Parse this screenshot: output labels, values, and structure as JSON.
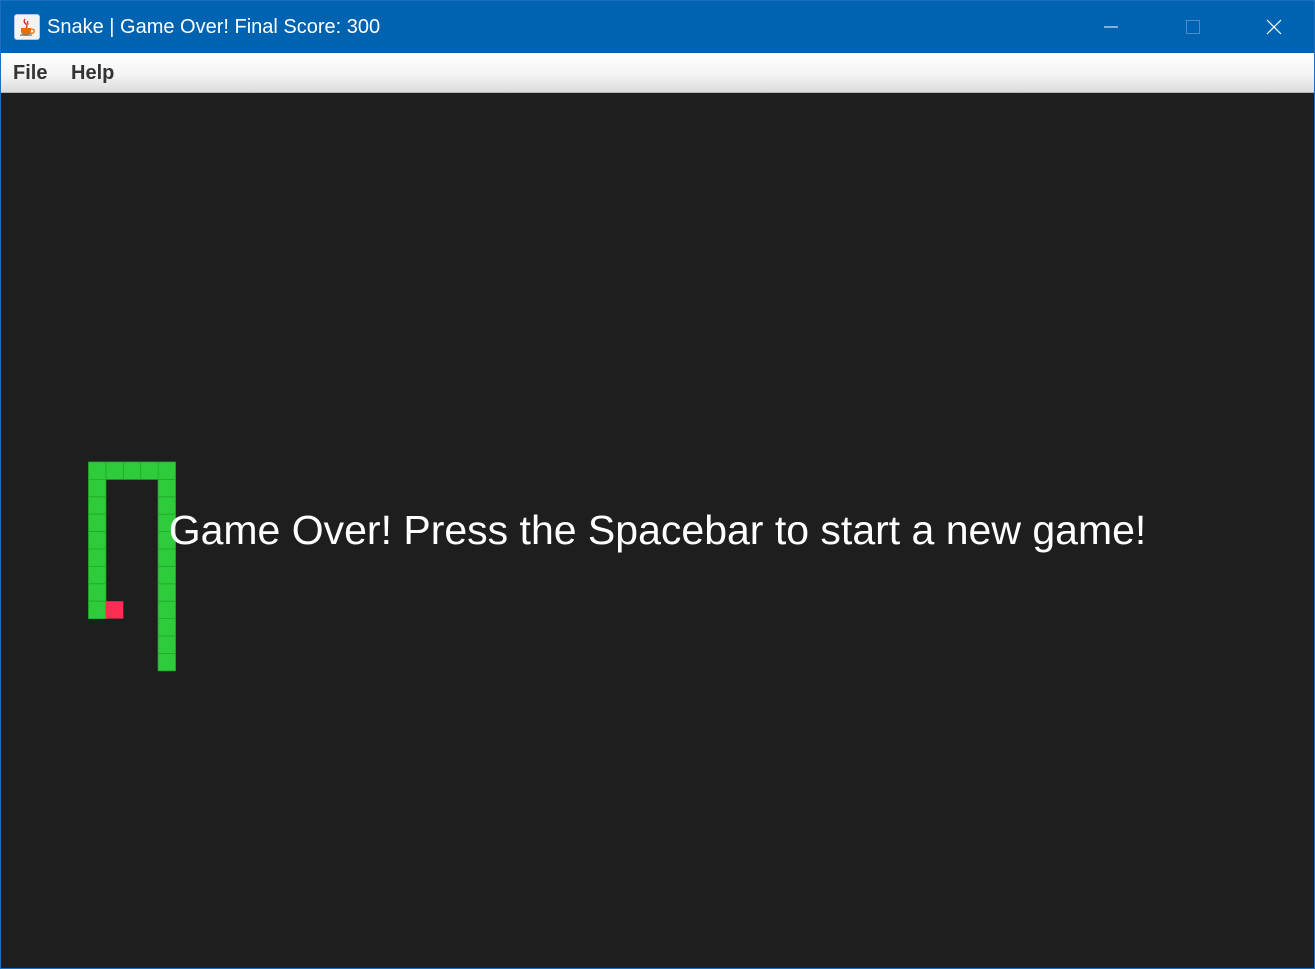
{
  "window": {
    "title": "Snake | Game Over! Final Score: 300",
    "app_icon": "java-cup-icon"
  },
  "window_controls": {
    "minimize_icon": "minimize-icon",
    "maximize_icon": "maximize-icon",
    "close_icon": "close-icon"
  },
  "menubar": {
    "items": [
      {
        "label": "File"
      },
      {
        "label": "Help"
      }
    ]
  },
  "game": {
    "message": "Game Over! Press the Spacebar to start a new game!",
    "final_score": 300,
    "colors": {
      "background": "#1e1e1e",
      "snake": "#2ecc3a",
      "snake_grid": "#22a82d",
      "food": "#ff2d55",
      "titlebar": "#0063b1"
    },
    "grid": {
      "cell_px_note": "cells",
      "snake_cells": [
        [
          9,
          31
        ],
        [
          9,
          30
        ],
        [
          9,
          29
        ],
        [
          9,
          28
        ],
        [
          9,
          27
        ],
        [
          9,
          26
        ],
        [
          9,
          25
        ],
        [
          9,
          24
        ],
        [
          9,
          23
        ],
        [
          9,
          22
        ],
        [
          9,
          21
        ],
        [
          9,
          20
        ],
        [
          8,
          20
        ],
        [
          7,
          20
        ],
        [
          6,
          20
        ],
        [
          5,
          20
        ],
        [
          5,
          21
        ],
        [
          5,
          22
        ],
        [
          5,
          23
        ],
        [
          5,
          24
        ],
        [
          5,
          25
        ],
        [
          5,
          26
        ],
        [
          5,
          27
        ],
        [
          5,
          28
        ]
      ],
      "food_cell": [
        6,
        28
      ]
    }
  }
}
